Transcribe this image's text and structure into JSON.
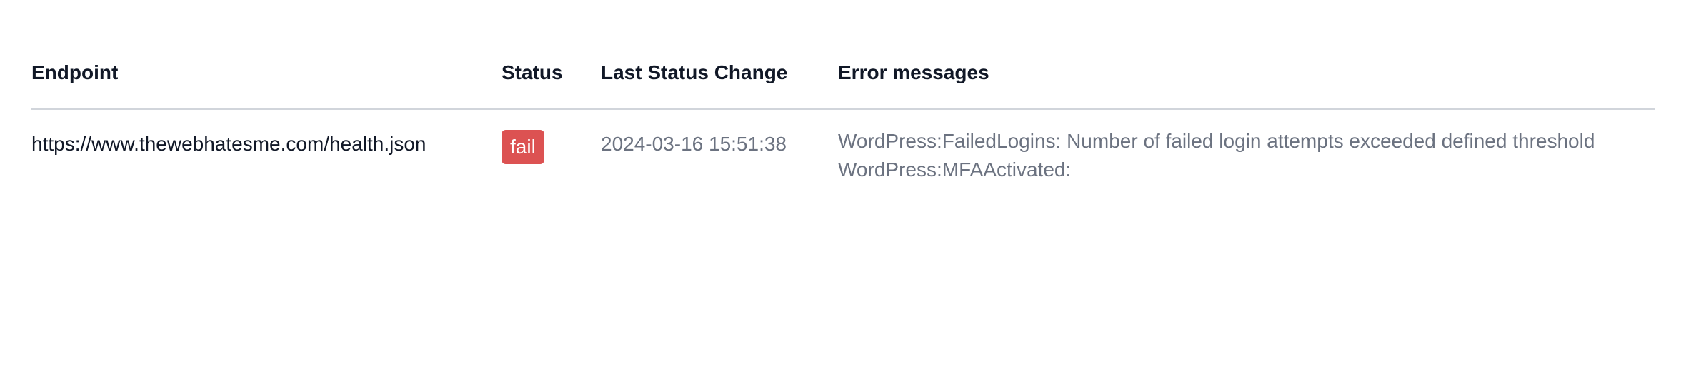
{
  "table": {
    "headers": {
      "endpoint": "Endpoint",
      "status": "Status",
      "last_status_change": "Last Status Change",
      "error_messages": "Error messages"
    },
    "rows": [
      {
        "endpoint": "https://www.thewebhatesme.com/health.json",
        "status": "fail",
        "last_status_change": "2024-03-16 15:51:38",
        "errors": [
          "WordPress:FailedLogins: Number of failed login attempts exceeded defined threshold",
          "WordPress:MFAActivated:"
        ]
      }
    ]
  },
  "colors": {
    "fail_badge": "#dc5252",
    "muted_text": "#6b7280",
    "divider": "#d1d5db"
  }
}
